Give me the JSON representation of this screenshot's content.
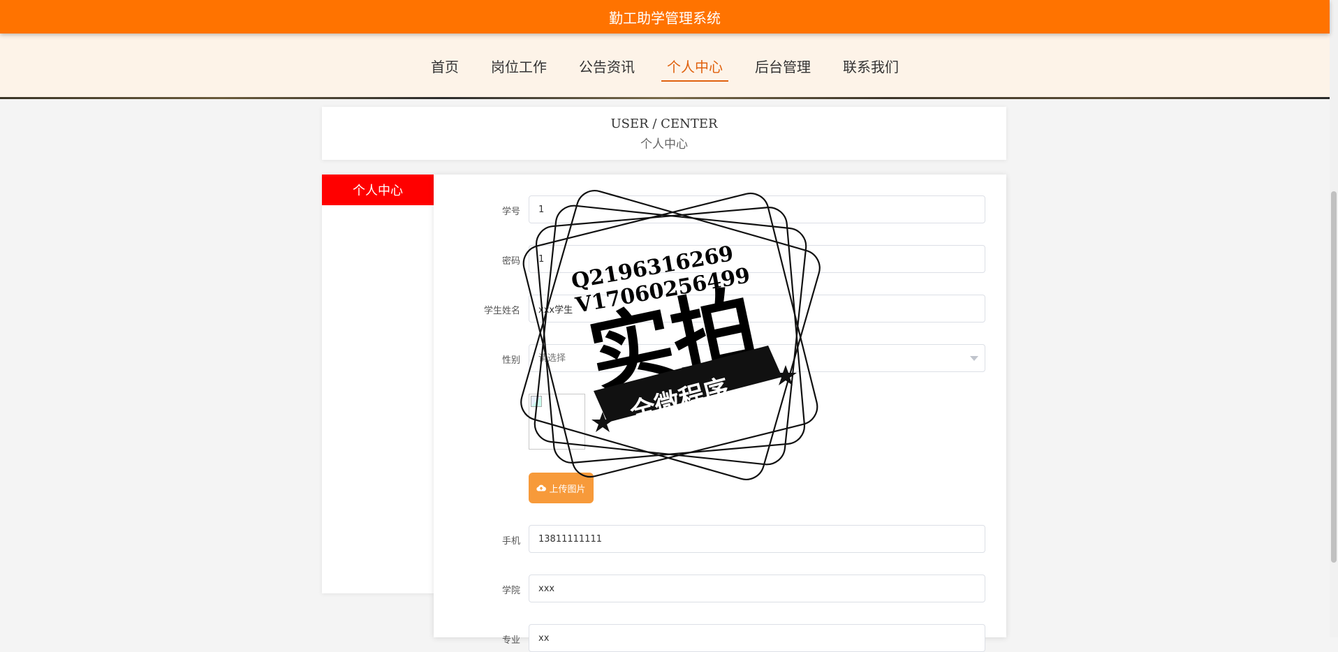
{
  "app": {
    "title": "勤工助学管理系统"
  },
  "nav": {
    "items": [
      {
        "label": "首页"
      },
      {
        "label": "岗位工作"
      },
      {
        "label": "公告资讯"
      },
      {
        "label": "个人中心",
        "active": true
      },
      {
        "label": "后台管理"
      },
      {
        "label": "联系我们"
      }
    ]
  },
  "header": {
    "title_en": "USER / CENTER",
    "title_cn": "个人中心"
  },
  "sidebar": {
    "active_label": "个人中心"
  },
  "form": {
    "student_id": {
      "label": "学号",
      "value": "1"
    },
    "password": {
      "label": "密码",
      "value": "1"
    },
    "student_name": {
      "label": "学生姓名",
      "value": "xxx学生"
    },
    "gender": {
      "label": "性别",
      "placeholder": "请选择"
    },
    "upload_button": "上传图片",
    "phone": {
      "label": "手机",
      "value": "13811111111"
    },
    "college": {
      "label": "学院",
      "value": "xxx"
    },
    "major": {
      "label": "专业",
      "value": "xx"
    }
  },
  "watermark": {
    "line1": "Q2196316269",
    "line2": "V17060256499",
    "main": "实拍",
    "banner": "全微程序"
  },
  "colors": {
    "top_bar": "#ff7300",
    "nav_active": "#e0620f",
    "sidebar_active": "#ff0000",
    "upload_button": "#f79a3a"
  }
}
